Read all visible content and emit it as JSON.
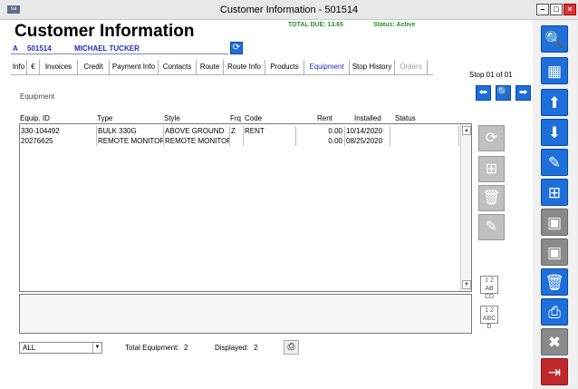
{
  "window": {
    "title": "Customer Information - 501514",
    "app_icon": "sisaw-app-icon"
  },
  "header": {
    "title": "Customer Information",
    "total_due": "TOTAL DUE: 13.65",
    "status": "Status: Active"
  },
  "customer": {
    "type_code": "A",
    "id": "501514",
    "name": "MICHAEL TUCKER"
  },
  "tabs": [
    {
      "label": "Info"
    },
    {
      "label": "€"
    },
    {
      "label": "Invoices"
    },
    {
      "label": "Credit"
    },
    {
      "label": "Payment Info"
    },
    {
      "label": "Contacts"
    },
    {
      "label": "Route"
    },
    {
      "label": "Route Info"
    },
    {
      "label": "Products"
    },
    {
      "label": "Equipment",
      "active": true
    },
    {
      "label": "Stop History"
    },
    {
      "label": "Orders",
      "disabled": true
    }
  ],
  "section_label": "Equipment",
  "stop_nav": {
    "text": "Stop 01 of 01"
  },
  "columns": [
    "Equip. ID",
    "Type",
    "Style",
    "Frq",
    "Code",
    "Rent",
    "Installed",
    "Status"
  ],
  "rows": [
    {
      "equip_id": "330-104492",
      "type": "BULK 330G",
      "style": "ABOVE GROUND",
      "frq": "Z",
      "code": "RENT",
      "rent": "0.00",
      "installed": "10/14/2020",
      "status": ""
    },
    {
      "equip_id": "20276625",
      "type": "REMOTE MONITOR",
      "style": "REMOTE MONITOR",
      "frq": "",
      "code": "",
      "rent": "0.00",
      "installed": "08/25/2020",
      "status": ""
    }
  ],
  "sort_buttons": [
    {
      "top": "1 2",
      "bottom": "AB CD"
    },
    {
      "top": "1 2",
      "bottom": "ABC D"
    }
  ],
  "footer": {
    "filter_value": "ALL",
    "total_label": "Total Equipment:",
    "total_value": "2",
    "displayed_label": "Displayed:",
    "displayed_value": "2"
  },
  "colors": {
    "accent_blue": "#1e6fd9",
    "status_green": "#2f8f2f",
    "customer_blue": "#1f2fbf",
    "danger_red": "#c0282b"
  }
}
